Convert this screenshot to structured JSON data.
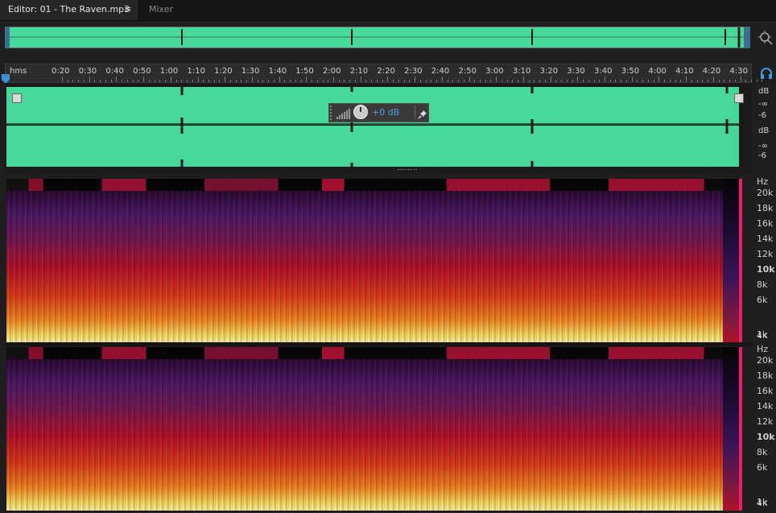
{
  "tabs": {
    "editor_label": "Editor: 01 - The Raven.mp3",
    "editor_menu_glyph": "≡",
    "mixer_label": "Mixer"
  },
  "ruler": {
    "unit": "hms",
    "ticks": [
      "0:20",
      "0:30",
      "0:40",
      "0:50",
      "1:00",
      "1:10",
      "1:20",
      "1:30",
      "1:40",
      "1:50",
      "2:00",
      "2:10",
      "2:20",
      "2:30",
      "2:40",
      "2:50",
      "3:00",
      "3:10",
      "3:20",
      "3:30",
      "3:40",
      "3:50",
      "4:00",
      "4:10",
      "4:20",
      "4:30"
    ]
  },
  "waveform": {
    "ch1_db": [
      "dB",
      "-∞",
      "-6"
    ],
    "ch2_db": [
      "dB",
      "-∞",
      "-6"
    ],
    "color": "#45d898"
  },
  "hud": {
    "value": "+0 dB"
  },
  "spectral": {
    "ch1_hz": [
      "Hz",
      "20k",
      "18k",
      "16k",
      "14k",
      "12k",
      "10k",
      "8k",
      "6k",
      "4k",
      "1k"
    ],
    "ch2_hz": [
      "Hz",
      "20k",
      "18k",
      "16k",
      "14k",
      "12k",
      "10k",
      "8k",
      "6k",
      "4k",
      "1k"
    ]
  },
  "icons": {
    "zoom": "zoom-icon",
    "headphones": "headphones-icon",
    "pin": "pin-icon",
    "playhead": "playhead-marker"
  }
}
